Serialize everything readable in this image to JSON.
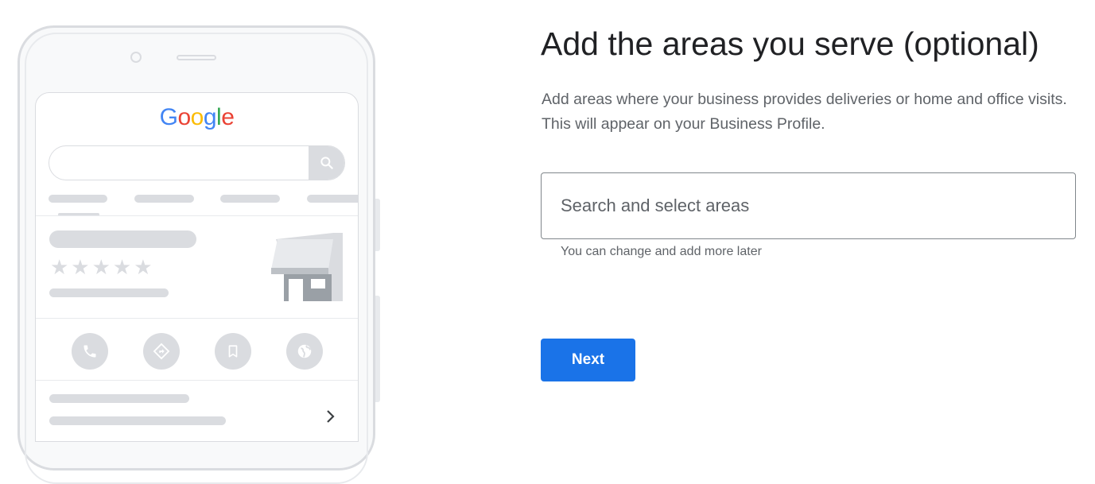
{
  "illustration": {
    "logo_letters": [
      {
        "char": "G",
        "color": "#4285F4"
      },
      {
        "char": "o",
        "color": "#EA4335"
      },
      {
        "char": "o",
        "color": "#FBBC05"
      },
      {
        "char": "g",
        "color": "#4285F4"
      },
      {
        "char": "l",
        "color": "#34A853"
      },
      {
        "char": "e",
        "color": "#EA4335"
      }
    ],
    "stars": "★★★★★",
    "action_icons": [
      "phone-icon",
      "directions-icon",
      "bookmark-icon",
      "globe-icon"
    ],
    "search_icon": "search-icon",
    "storefront_icon": "storefront-icon",
    "chevron_icon": "chevron-right-icon"
  },
  "page": {
    "title": "Add the areas you serve (optional)",
    "description": "Add areas where your business provides deliveries or home and office visits. This will appear on your Business Profile.",
    "areas_input": {
      "placeholder": "Search and select areas",
      "value": ""
    },
    "helper_text": "You can change and add more later",
    "next_label": "Next"
  },
  "colors": {
    "primary": "#1a73e8",
    "text_primary": "#202124",
    "text_secondary": "#5f6368",
    "placeholder_gray": "#dadce0"
  }
}
